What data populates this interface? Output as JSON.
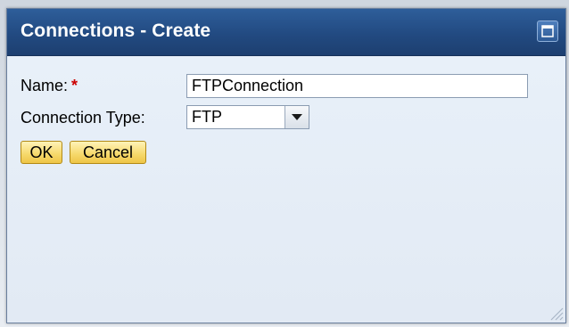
{
  "dialog": {
    "title": "Connections - Create",
    "maximize_icon": "maximize-icon",
    "resize_icon": "resize-grip-icon"
  },
  "form": {
    "name_label": "Name:",
    "required_marker": "*",
    "name_value": "FTPConnection",
    "type_label": "Connection Type:",
    "type_value": "FTP",
    "dropdown_icon": "chevron-down-icon"
  },
  "buttons": {
    "ok_label": "OK",
    "cancel_label": "Cancel"
  },
  "colors": {
    "titlebar": "#224a81",
    "content_bg": "#e6eef7",
    "button_bg": "#f6d86a",
    "required": "#cc0000"
  }
}
